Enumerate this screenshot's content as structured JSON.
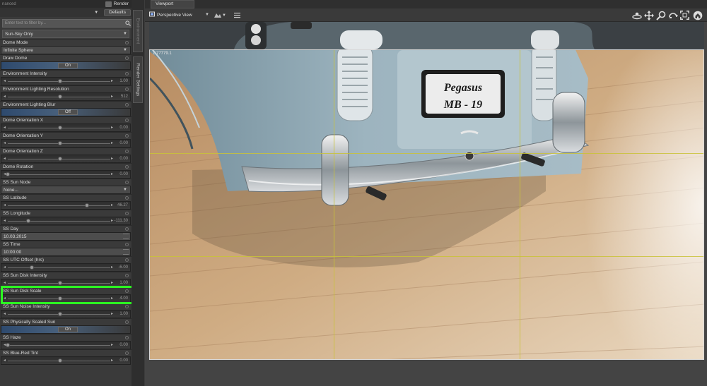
{
  "left_panel": {
    "tab_label": "nanced",
    "render_label": "Render",
    "defaults_label": "Defaults",
    "filter_placeholder": "Enter text to filter by...",
    "preset_value": "Sun-Sky Only",
    "side_tabs": [
      "Environment",
      "Render Settings"
    ],
    "properties": [
      {
        "label": "Dome Mode",
        "type": "dropdown",
        "value": "Infinite Sphere"
      },
      {
        "label": "Draw Dome",
        "type": "toggle",
        "value": "On"
      },
      {
        "label": "Environment Intensity",
        "type": "slider",
        "value": "1.00",
        "level": 0.5
      },
      {
        "label": "Environment Lighting Resolution",
        "type": "slider",
        "value": "512",
        "level": 0.5
      },
      {
        "label": "Environment Lighting Blur",
        "type": "toggle",
        "value": "Off"
      },
      {
        "label": "Dome Orientation X",
        "type": "slider",
        "value": "0.00",
        "level": 0.5
      },
      {
        "label": "Dome Orientation Y",
        "type": "slider",
        "value": "0.00",
        "level": 0.5
      },
      {
        "label": "Dome Orientation Z",
        "type": "slider",
        "value": "0.00",
        "level": 0.5
      },
      {
        "label": "Dome Rotation",
        "type": "slider",
        "value": "0.00",
        "level": 0.0
      },
      {
        "label": "SS Sun Node",
        "type": "dropdown",
        "value": "None..."
      },
      {
        "label": "SS Latitude",
        "type": "slider",
        "value": "46.27",
        "level": 0.76
      },
      {
        "label": "SS Longitude",
        "type": "slider",
        "value": "-111.30",
        "level": 0.2
      },
      {
        "label": "SS Day",
        "type": "field",
        "value": "10.03.2015"
      },
      {
        "label": "SS Time",
        "type": "field",
        "value": "10:00:00"
      },
      {
        "label": "SS UTC Offset (hrs)",
        "type": "slider",
        "value": "-6.00",
        "level": 0.23
      },
      {
        "label": "SS Sun Disk Intensity",
        "type": "slider",
        "value": "1.00",
        "level": 0.5
      },
      {
        "label": "SS Sun Disk Scale",
        "type": "slider",
        "value": "4.00",
        "level": 0.5
      },
      {
        "label": "SS Sun Noise Intensity",
        "type": "slider",
        "value": "1.00",
        "level": 0.5
      },
      {
        "label": "SS Physically Scaled Sun",
        "type": "toggle",
        "value": "On"
      },
      {
        "label": "SS Haze",
        "type": "slider",
        "value": "0.00",
        "level": 0.0
      },
      {
        "label": "SS Blue-Red Tint",
        "type": "slider",
        "value": "0.00",
        "level": 0.5
      }
    ]
  },
  "viewport": {
    "tab_label": "Viewport",
    "camera_label": "Perspective View",
    "render_label": "1:77779.1",
    "plate_line1": "Pegasus",
    "plate_line2": "MB - 19"
  },
  "colors": {
    "highlight": "#2cff22",
    "guide_lines": "#c9c238",
    "floor_wood": "#c9a27a"
  },
  "icons": [
    "search-icon",
    "chevron-down-icon",
    "render-icon",
    "camera-icon",
    "menu-icon",
    "orbit-icon",
    "pan-icon",
    "zoom-icon",
    "roll-icon",
    "frame-icon",
    "home-icon"
  ]
}
